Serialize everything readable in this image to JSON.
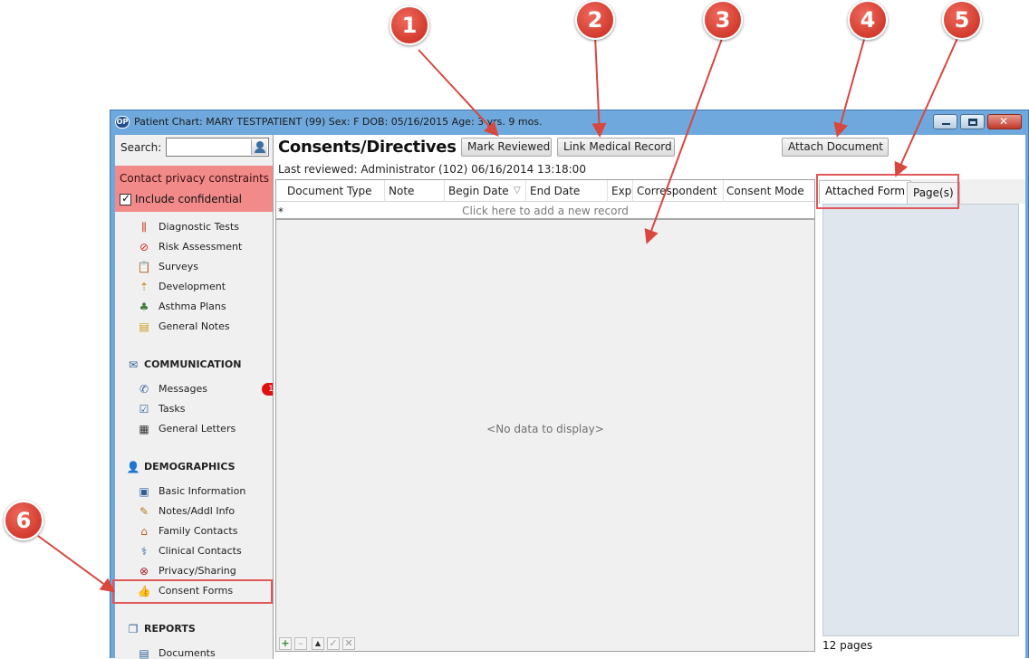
{
  "window": {
    "title": "Patient Chart: MARY TESTPATIENT (99)  Sex: F  DOB: 05/16/2015  Age: 3 yrs. 9 mos.",
    "app_logo": "OP",
    "controls": [
      "minimize-icon",
      "restore-icon",
      "close-icon"
    ]
  },
  "sidebar": {
    "search_label": "Search:",
    "search_value": "",
    "privacy": {
      "title": "Contact privacy constraints",
      "include_confidential_label": "Include confidential",
      "include_confidential_checked": true,
      "check_glyph": "✓"
    },
    "clinical_items": [
      {
        "label": "Diagnostic Tests",
        "icon": "test-tubes-icon"
      },
      {
        "label": "Risk Assessment",
        "icon": "no-sign-icon"
      },
      {
        "label": "Surveys",
        "icon": "clipboard-icon"
      },
      {
        "label": "Development",
        "icon": "growth-icon"
      },
      {
        "label": "Asthma Plans",
        "icon": "lungs-icon"
      },
      {
        "label": "General Notes",
        "icon": "note-icon"
      }
    ],
    "communication": {
      "title": "COMMUNICATION",
      "items": [
        {
          "label": "Messages",
          "icon": "phone-icon",
          "badge": "1"
        },
        {
          "label": "Tasks",
          "icon": "task-check-icon"
        },
        {
          "label": "General Letters",
          "icon": "letter-icon"
        }
      ]
    },
    "demographics": {
      "title": "DEMOGRAPHICS",
      "items": [
        {
          "label": "Basic Information",
          "icon": "id-card-icon"
        },
        {
          "label": "Notes/Addl Info",
          "icon": "notepad-icon"
        },
        {
          "label": "Family Contacts",
          "icon": "house-icon"
        },
        {
          "label": "Clinical Contacts",
          "icon": "doctor-icon"
        },
        {
          "label": "Privacy/Sharing",
          "icon": "eye-slash-icon"
        },
        {
          "label": "Consent Forms",
          "icon": "thumbs-up-icon"
        }
      ]
    },
    "reports": {
      "title": "REPORTS",
      "items": [
        {
          "label": "Documents",
          "icon": "document-icon"
        }
      ]
    }
  },
  "main": {
    "title": "Consents/Directives",
    "mark_reviewed": "Mark Reviewed",
    "link_medical_record": "Link Medical Record",
    "attach_document": "Attach Document",
    "last_reviewed_label": "Last reviewed:",
    "last_reviewed_value": "Administrator (102) 06/16/2014 13:18:00",
    "grid": {
      "columns": [
        "Document Type",
        "Note",
        "Begin Date",
        "End Date",
        "Exp",
        "Correspondent",
        "Consent Mode"
      ],
      "sort_glyph": "▽",
      "new_row_marker": "*",
      "new_row_text": "Click here to add a new record",
      "empty_text": "<No data to display>",
      "navigator": [
        "+",
        "–",
        "▲",
        "✓",
        "✕"
      ]
    }
  },
  "right_panel": {
    "tabs": [
      "Attached Form",
      "Page(s)"
    ],
    "active_tab": "Attached Form",
    "footer": "12 pages"
  },
  "callouts": [
    "1",
    "2",
    "3",
    "4",
    "5",
    "6"
  ],
  "colors": {
    "callout": "#d23b2d",
    "privacy_band": "#f28a8a",
    "window_frame": "#6fa8dc",
    "panel": "#dfe6ee"
  }
}
